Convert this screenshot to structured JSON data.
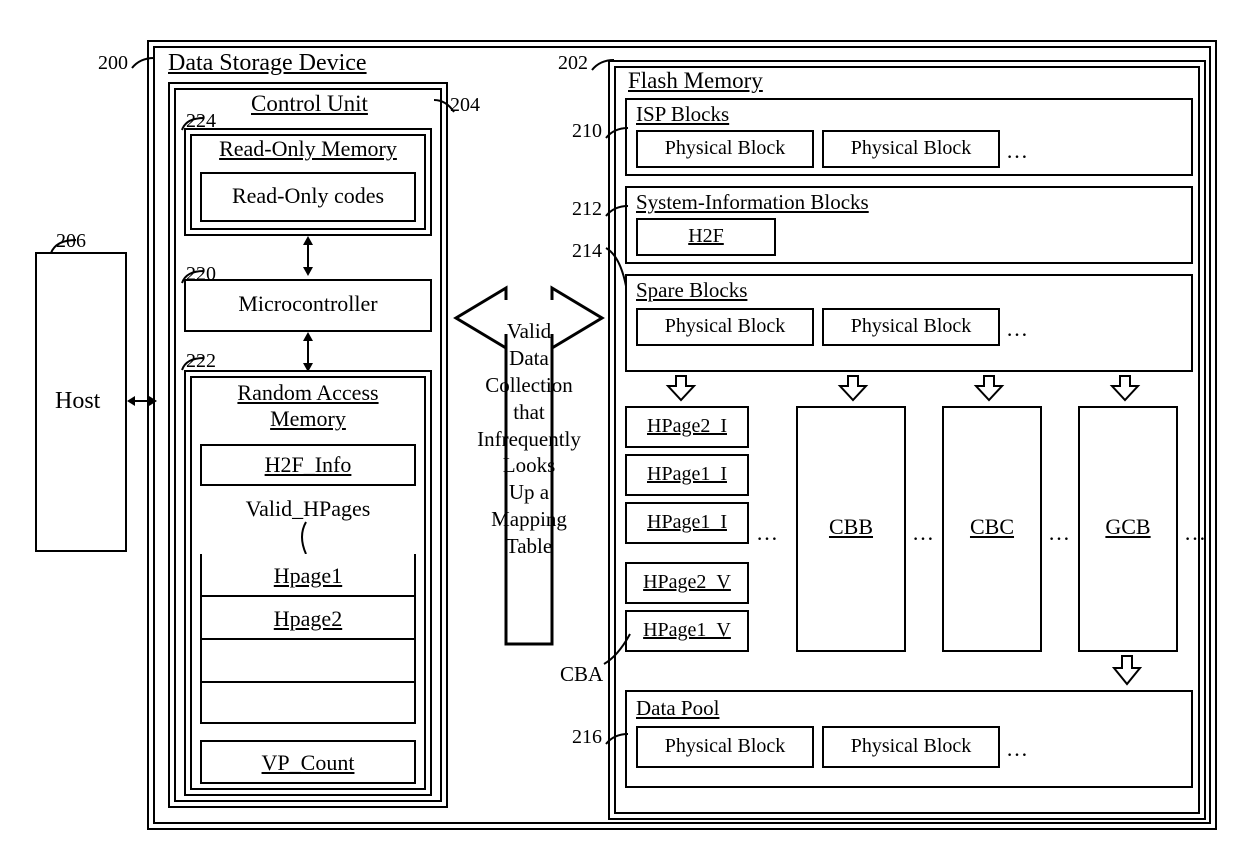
{
  "refs": {
    "r200": "200",
    "r202": "202",
    "r204": "204",
    "r206": "206",
    "r210": "210",
    "r212": "212",
    "r214": "214",
    "r216": "216",
    "r220": "220",
    "r222": "222",
    "r224": "224"
  },
  "host": "Host",
  "device_title": "Data Storage Device",
  "control_unit": {
    "title": "Control Unit",
    "rom_title": "Read-Only Memory",
    "rom_codes": "Read-Only codes",
    "micro": "Microcontroller",
    "ram_title": "Random Access\nMemory",
    "h2f_info": "H2F_Info",
    "valid_hpages": "Valid_HPages",
    "hpage1": "Hpage1",
    "hpage2": "Hpage2",
    "vp_count": "VP_Count"
  },
  "bigarrow_text": "Valid\nData\nCollection\nthat\nInfrequently\nLooks\nUp a\nMapping\nTable",
  "flash": {
    "title": "Flash Memory",
    "isp": "ISP Blocks",
    "pblock": "Physical Block",
    "sysinfo": "System-Information Blocks",
    "h2f": "H2F",
    "spare": "Spare Blocks",
    "data_pool": "Data Pool",
    "cba_pages": [
      "HPage2_I",
      "HPage1_I",
      "HPage1_I",
      "HPage2_V",
      "HPage1_V"
    ],
    "cba_label": "CBA",
    "cbb": "CBB",
    "cbc": "CBC",
    "gcb": "GCB",
    "dots": "…"
  }
}
